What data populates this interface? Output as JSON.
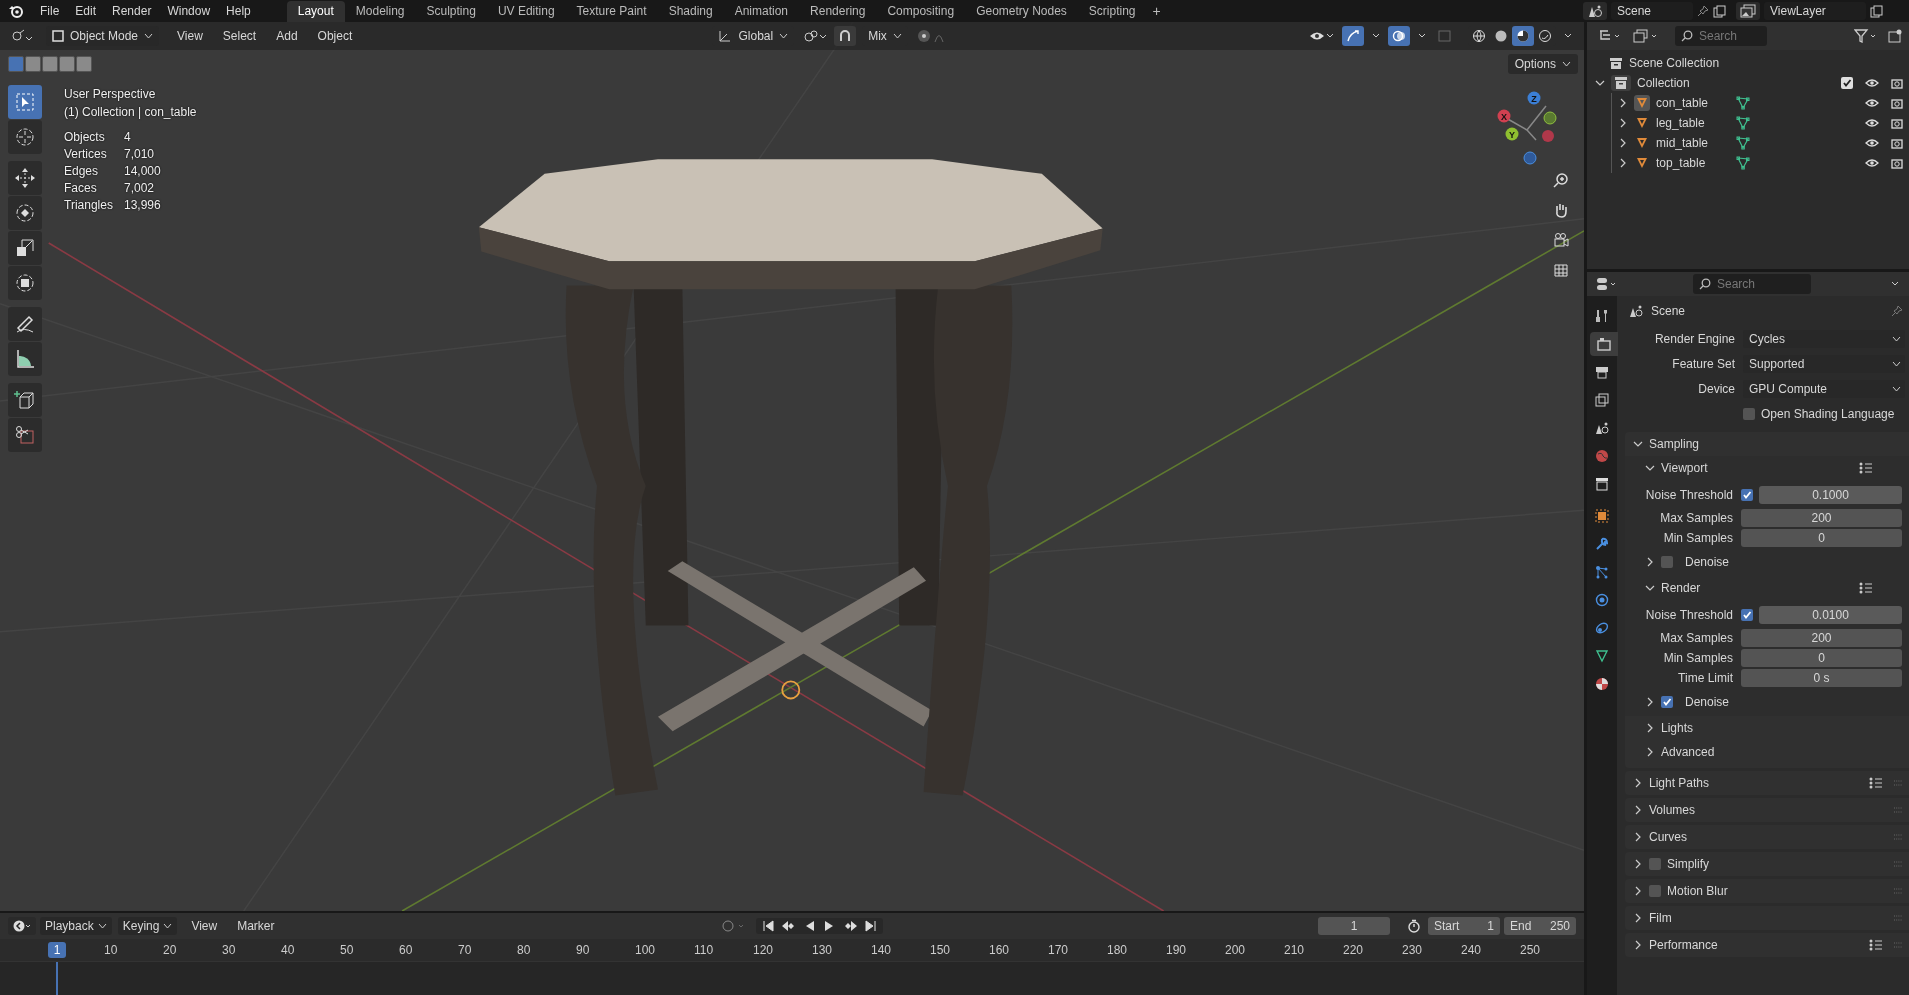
{
  "top_bar": {
    "menus": [
      "File",
      "Edit",
      "Render",
      "Window",
      "Help"
    ],
    "workspaces": [
      {
        "label": "Layout",
        "selected": true
      },
      {
        "label": "Modeling",
        "selected": false
      },
      {
        "label": "Sculpting",
        "selected": false
      },
      {
        "label": "UV Editing",
        "selected": false
      },
      {
        "label": "Texture Paint",
        "selected": false
      },
      {
        "label": "Shading",
        "selected": false
      },
      {
        "label": "Animation",
        "selected": false
      },
      {
        "label": "Rendering",
        "selected": false
      },
      {
        "label": "Compositing",
        "selected": false
      },
      {
        "label": "Geometry Nodes",
        "selected": false
      },
      {
        "label": "Scripting",
        "selected": false
      }
    ],
    "add_tab": "+",
    "scene": "Scene",
    "view_layer": "ViewLayer"
  },
  "viewport": {
    "mode": "Object Mode",
    "menus": [
      "View",
      "Select",
      "Add",
      "Object"
    ],
    "orientation": "Global",
    "snap_target": "Mix",
    "options": "Options",
    "select_modes": [
      {
        "selected": true
      },
      {
        "selected": false
      },
      {
        "selected": false
      },
      {
        "selected": false
      },
      {
        "selected": false
      }
    ],
    "shading": [
      {
        "kind": "wireframe",
        "selected": false
      },
      {
        "kind": "solid",
        "selected": false
      },
      {
        "kind": "material",
        "selected": true
      },
      {
        "kind": "rendered",
        "selected": false
      }
    ],
    "tools": [
      {
        "kind": "select",
        "selected": true
      },
      {
        "kind": "cursor",
        "selected": false
      },
      {
        "kind": "move",
        "selected": false
      },
      {
        "kind": "rotate",
        "selected": false
      },
      {
        "kind": "scale",
        "selected": false
      },
      {
        "kind": "transform",
        "selected": false
      },
      {
        "kind": "annotate",
        "selected": false
      },
      {
        "kind": "measure",
        "selected": false
      },
      {
        "kind": "add_cube",
        "selected": false
      },
      {
        "kind": "scissors",
        "selected": false
      }
    ],
    "view_name": "User Perspective",
    "context": "(1) Collection | con_table",
    "stats": [
      {
        "label": "Objects",
        "value": "4"
      },
      {
        "label": "Vertices",
        "value": "7,010"
      },
      {
        "label": "Edges",
        "value": "14,000"
      },
      {
        "label": "Faces",
        "value": "7,002"
      },
      {
        "label": "Triangles",
        "value": "13,996"
      }
    ],
    "gizmo": {
      "x": "X",
      "y": "Y",
      "z": "Z"
    }
  },
  "outliner": {
    "search_placeholder": "Search",
    "root": "Scene Collection",
    "collection": {
      "name": "Collection",
      "expanded": true,
      "checked": true,
      "children": [
        {
          "name": "con_table",
          "selected": true,
          "expanded": false
        },
        {
          "name": "leg_table",
          "selected": false,
          "expanded": false
        },
        {
          "name": "mid_table",
          "selected": false,
          "expanded": false
        },
        {
          "name": "top_table",
          "selected": false,
          "expanded": false
        }
      ]
    }
  },
  "properties": {
    "search_placeholder": "Search",
    "context": "Scene",
    "tabs": [
      {
        "kind": "tool",
        "selected": false
      },
      {
        "kind": "render",
        "selected": true
      },
      {
        "kind": "output",
        "selected": false
      },
      {
        "kind": "view_layer",
        "selected": false
      },
      {
        "kind": "scene",
        "selected": false
      },
      {
        "kind": "world",
        "selected": false
      },
      {
        "kind": "collection",
        "selected": false
      },
      {
        "kind": "object",
        "selected": false
      },
      {
        "kind": "modifiers",
        "selected": false
      },
      {
        "kind": "particles",
        "selected": false
      },
      {
        "kind": "physics",
        "selected": false
      },
      {
        "kind": "constraints",
        "selected": false
      },
      {
        "kind": "data",
        "selected": false
      },
      {
        "kind": "material",
        "selected": false
      }
    ],
    "fields": [
      {
        "label": "Render Engine",
        "value": "Cycles"
      },
      {
        "label": "Feature Set",
        "value": "Supported"
      },
      {
        "label": "Device",
        "value": "GPU Compute"
      }
    ],
    "osl": {
      "label": "Open Shading Language",
      "checked": false
    },
    "sampling": {
      "title": "Sampling",
      "expanded": true,
      "subpanels": [
        {
          "title": "Viewport",
          "expanded": true,
          "kind": "presets",
          "rows": [
            {
              "kind": "check_number",
              "label": "Noise Threshold",
              "checked": true,
              "value": "0.1000"
            },
            {
              "kind": "number",
              "label": "Max Samples",
              "value": "200"
            },
            {
              "kind": "number",
              "label": "Min Samples",
              "value": "0"
            }
          ],
          "denoise": {
            "label": "Denoise",
            "checked": false,
            "expanded": false
          }
        },
        {
          "title": "Render",
          "expanded": true,
          "kind": "presets",
          "rows": [
            {
              "kind": "check_number",
              "label": "Noise Threshold",
              "checked": true,
              "value": "0.0100"
            },
            {
              "kind": "number",
              "label": "Max Samples",
              "value": "200"
            },
            {
              "kind": "number",
              "label": "Min Samples",
              "value": "0"
            },
            {
              "kind": "number",
              "label": "Time Limit",
              "value": "0 s"
            }
          ],
          "denoise": {
            "label": "Denoise",
            "checked": true,
            "expanded": false
          }
        },
        {
          "title": "Lights",
          "expanded": false,
          "kind": "plain"
        },
        {
          "title": "Advanced",
          "expanded": false,
          "kind": "plain"
        }
      ]
    },
    "panels": [
      {
        "title": "Light Paths",
        "expanded": false,
        "kind": "presets"
      },
      {
        "title": "Volumes",
        "expanded": false,
        "kind": "plain"
      },
      {
        "title": "Curves",
        "expanded": false,
        "kind": "plain"
      },
      {
        "title": "Simplify",
        "expanded": false,
        "kind": "toggle",
        "checked": false
      },
      {
        "title": "Motion Blur",
        "expanded": false,
        "kind": "toggle",
        "checked": false
      },
      {
        "title": "Film",
        "expanded": false,
        "kind": "plain"
      },
      {
        "title": "Performance",
        "expanded": false,
        "kind": "presets"
      }
    ]
  },
  "timeline": {
    "menus": [
      "Playback",
      "Keying",
      "View",
      "Marker"
    ],
    "current_frame": "1",
    "start_label": "Start",
    "start": "1",
    "end_label": "End",
    "end": "250",
    "playhead": "1",
    "ruler": [
      "10",
      "20",
      "30",
      "40",
      "50",
      "60",
      "70",
      "80",
      "90",
      "100",
      "110",
      "120",
      "130",
      "140",
      "150",
      "160",
      "170",
      "180",
      "190",
      "200",
      "210",
      "220",
      "230",
      "240",
      "250"
    ]
  }
}
